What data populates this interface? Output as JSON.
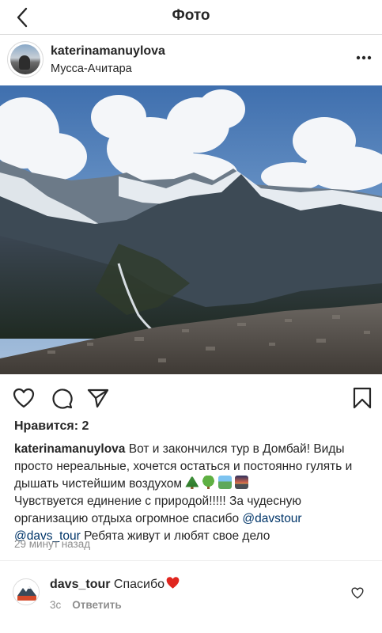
{
  "topbar": {
    "title": "Фото"
  },
  "post": {
    "username": "katerinamanuylova",
    "location": "Мусса-Ачитара",
    "likes_text": "Нравится: 2",
    "caption": {
      "user": "katerinamanuylova",
      "part1": " Вот и закончился тур в Домбай! Виды просто нереальные, хочется остаться и постоянно гулять и дышать чистейшим воздухом",
      "part2": "Чувствуется единение с природой!!!!! За чудесную организацию отдыха огромное спасибо",
      "mention1": "@davstour",
      "mention2": "@davs_tour",
      "part3": " Ребята живут и любят свое дело",
      "emojis": [
        "evergreen-tree",
        "deciduous-tree",
        "national-park",
        "sunset"
      ]
    },
    "timestamp": "29 минут назад"
  },
  "comment": {
    "user": "davs_tour",
    "text": "Спасибо",
    "time": "3с",
    "reply_label": "Ответить",
    "avatar_logo_text": "ДАВС ТУР"
  },
  "icons": {
    "back": "chevron-left-icon",
    "more": "ellipsis-icon",
    "like": "heart-icon",
    "comment": "comment-bubble-icon",
    "share": "paper-plane-icon",
    "save": "bookmark-icon"
  },
  "colors": {
    "text": "#262626",
    "muted": "#8e8e8e",
    "mention": "#003569",
    "heart": "#ed4956"
  }
}
